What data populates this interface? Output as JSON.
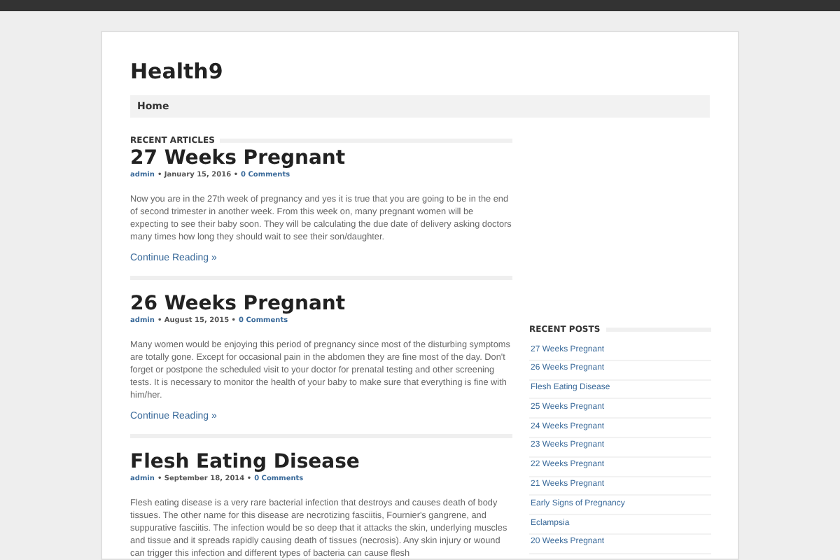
{
  "site": {
    "title": "Health9"
  },
  "nav": [
    {
      "label": "Home"
    }
  ],
  "recent_articles": {
    "heading": "RECENT ARTICLES",
    "posts": [
      {
        "title": "27 Weeks Pregnant",
        "author": "admin",
        "date": "• January 15, 2016 •",
        "comments": "0 Comments",
        "excerpt": "Now you are in the 27th week of pregnancy and yes it is true that you are going to be in the end of second trimester in another week. From this week on, many pregnant women will be expecting to see their baby soon. They will be calculating the due date of delivery asking doctors many times how long they should wait to see their son/daughter.",
        "more": "Continue Reading »"
      },
      {
        "title": "26 Weeks Pregnant",
        "author": "admin",
        "date": "• August 15, 2015 •",
        "comments": "0 Comments",
        "excerpt": "Many women would be enjoying this period of pregnancy since most of the disturbing symptoms are totally gone. Except for occasional pain in the abdomen they are fine most of the day. Don't forget or postpone the scheduled visit to your doctor for prenatal testing and other screening tests. It is necessary to monitor the health of your baby to make sure that everything is fine with him/her.",
        "more": "Continue Reading »"
      },
      {
        "title": "Flesh Eating Disease",
        "author": "admin",
        "date": "• September 18, 2014 •",
        "comments": "0 Comments",
        "excerpt": "Flesh eating disease is a very rare bacterial infection that destroys and causes death of body tissues. The other name for this disease are necrotizing fasciitis, Fournier's gangrene, and suppurative fasciitis. The infection would be so deep that it attacks the skin, underlying muscles and tissue and it spreads rapidly causing death of tissues (necrosis). Any skin injury or wound can trigger this infection and different types of bacteria can cause flesh"
      }
    ]
  },
  "recent_posts": {
    "heading": "RECENT POSTS",
    "items": [
      "27 Weeks Pregnant",
      "26 Weeks Pregnant",
      "Flesh Eating Disease",
      "25 Weeks Pregnant",
      "24 Weeks Pregnant",
      "23 Weeks Pregnant",
      "22 Weeks Pregnant",
      "21 Weeks Pregnant",
      "Early Signs of Pregnancy",
      "Eclampsia",
      "20 Weeks Pregnant"
    ]
  }
}
